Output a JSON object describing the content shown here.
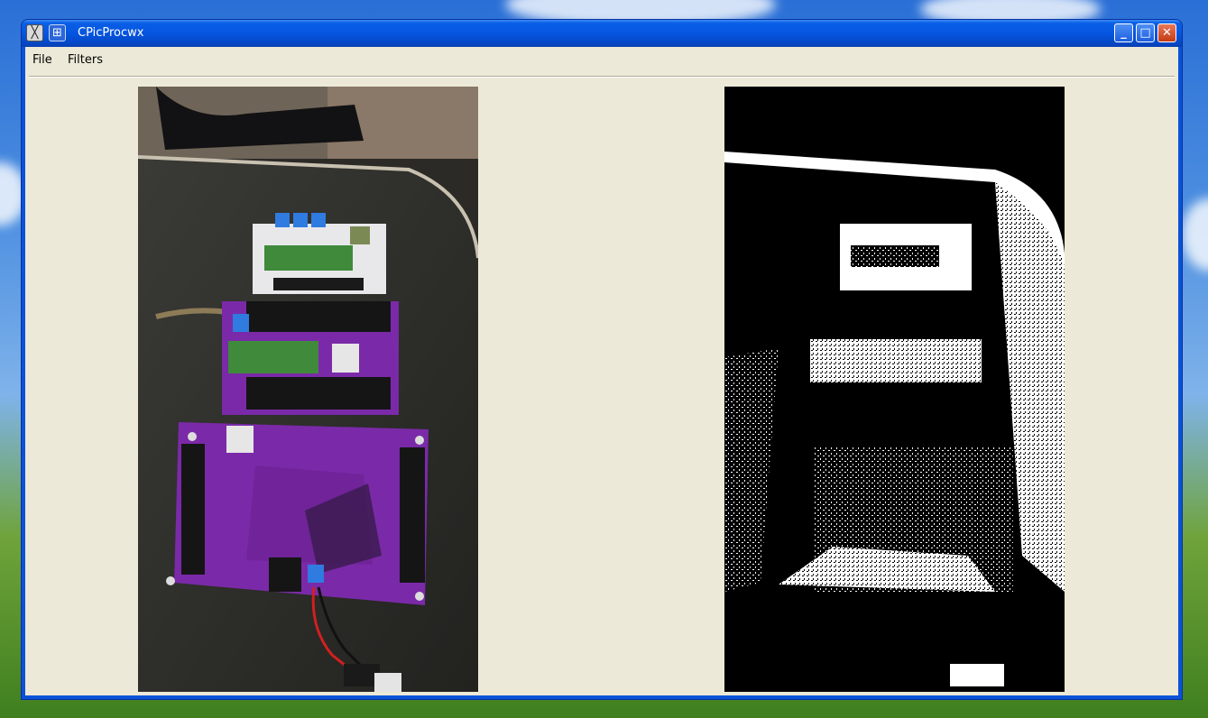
{
  "window": {
    "title": "CPicProcwx",
    "buttons": {
      "minimize": "minimize",
      "maximize": "maximize",
      "close": "close"
    }
  },
  "menu": {
    "items": [
      {
        "label": "File"
      },
      {
        "label": "Filters"
      }
    ]
  },
  "images": {
    "original": {
      "kind": "color photo of circuit boards"
    },
    "processed": {
      "kind": "black and white thresholded image"
    }
  },
  "colors": {
    "title_bar": "#0a5fe6",
    "client_bg": "#ece9d8",
    "pcb_purple": "#7a2aa8",
    "terminal_blue": "#2f7be0"
  }
}
